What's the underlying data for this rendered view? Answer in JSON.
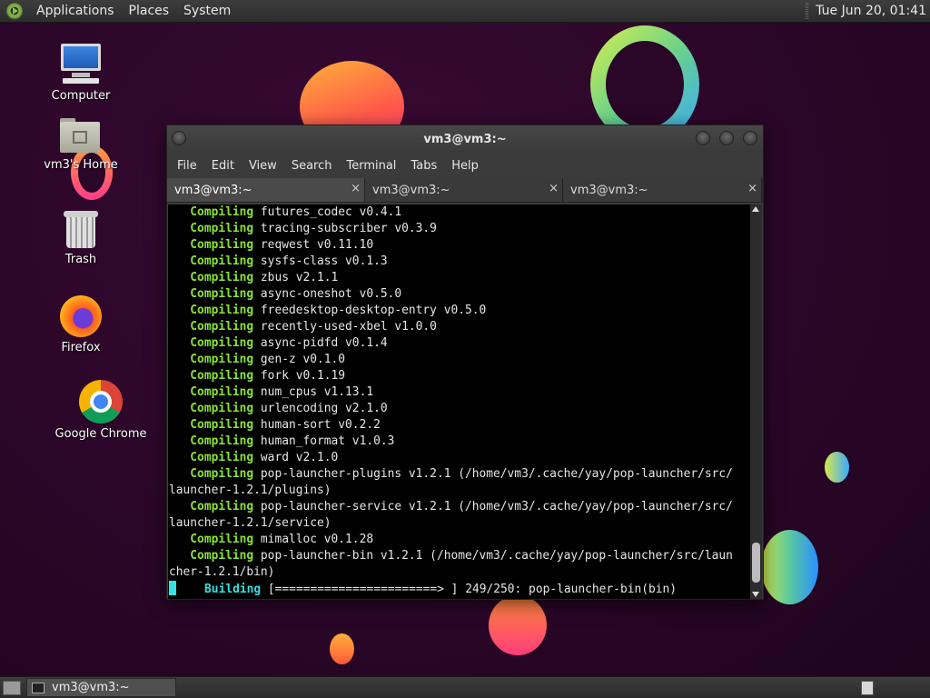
{
  "top_panel": {
    "menus": [
      "Applications",
      "Places",
      "System"
    ],
    "clock": "Tue Jun 20, 01:41"
  },
  "desktop_icons": [
    {
      "label": "Computer",
      "icon": "computer-icon"
    },
    {
      "label": "vm3's Home",
      "icon": "home-folder-icon"
    },
    {
      "label": "Trash",
      "icon": "trash-icon"
    },
    {
      "label": "Firefox",
      "icon": "firefox-icon"
    },
    {
      "label": "Google Chrome",
      "icon": "chrome-icon"
    }
  ],
  "window": {
    "title": "vm3@vm3:~",
    "menus": [
      "File",
      "Edit",
      "View",
      "Search",
      "Terminal",
      "Tabs",
      "Help"
    ],
    "tabs": [
      "vm3@vm3:~",
      "vm3@vm3:~",
      "vm3@vm3:~"
    ],
    "tab_close": "×",
    "terminal_lines": [
      {
        "kw": "Compiling",
        "text": " futures_codec v0.4.1"
      },
      {
        "kw": "Compiling",
        "text": " tracing-subscriber v0.3.9"
      },
      {
        "kw": "Compiling",
        "text": " reqwest v0.11.10"
      },
      {
        "kw": "Compiling",
        "text": " sysfs-class v0.1.3"
      },
      {
        "kw": "Compiling",
        "text": " zbus v2.1.1"
      },
      {
        "kw": "Compiling",
        "text": " async-oneshot v0.5.0"
      },
      {
        "kw": "Compiling",
        "text": " freedesktop-desktop-entry v0.5.0"
      },
      {
        "kw": "Compiling",
        "text": " recently-used-xbel v1.0.0"
      },
      {
        "kw": "Compiling",
        "text": " async-pidfd v0.1.4"
      },
      {
        "kw": "Compiling",
        "text": " gen-z v0.1.0"
      },
      {
        "kw": "Compiling",
        "text": " fork v0.1.19"
      },
      {
        "kw": "Compiling",
        "text": " num_cpus v1.13.1"
      },
      {
        "kw": "Compiling",
        "text": " urlencoding v2.1.0"
      },
      {
        "kw": "Compiling",
        "text": " human-sort v0.2.2"
      },
      {
        "kw": "Compiling",
        "text": " human_format v1.0.3"
      },
      {
        "kw": "Compiling",
        "text": " ward v2.1.0"
      },
      {
        "kw": "Compiling",
        "text": " pop-launcher-plugins v1.2.1 (/home/vm3/.cache/yay/pop-launcher/src/"
      },
      {
        "kw": "",
        "text": "launcher-1.2.1/plugins)"
      },
      {
        "kw": "Compiling",
        "text": " pop-launcher-service v1.2.1 (/home/vm3/.cache/yay/pop-launcher/src/"
      },
      {
        "kw": "",
        "text": "launcher-1.2.1/service)"
      },
      {
        "kw": "Compiling",
        "text": " mimalloc v0.1.28"
      },
      {
        "kw": "Compiling",
        "text": " pop-launcher-bin v1.2.1 (/home/vm3/.cache/yay/pop-launcher/src/laun"
      },
      {
        "kw": "",
        "text": "cher-1.2.1/bin)"
      }
    ],
    "building_label": "Building",
    "building_text": " [=======================> ] 249/250: pop-launcher-bin(bin)",
    "progress_fraction": 0.996
  },
  "taskbar": {
    "tasks": [
      "vm3@vm3:~"
    ]
  },
  "colors": {
    "terminal_keyword": "#8ae234",
    "terminal_building": "#34e2e2",
    "background": "#2a0628"
  }
}
